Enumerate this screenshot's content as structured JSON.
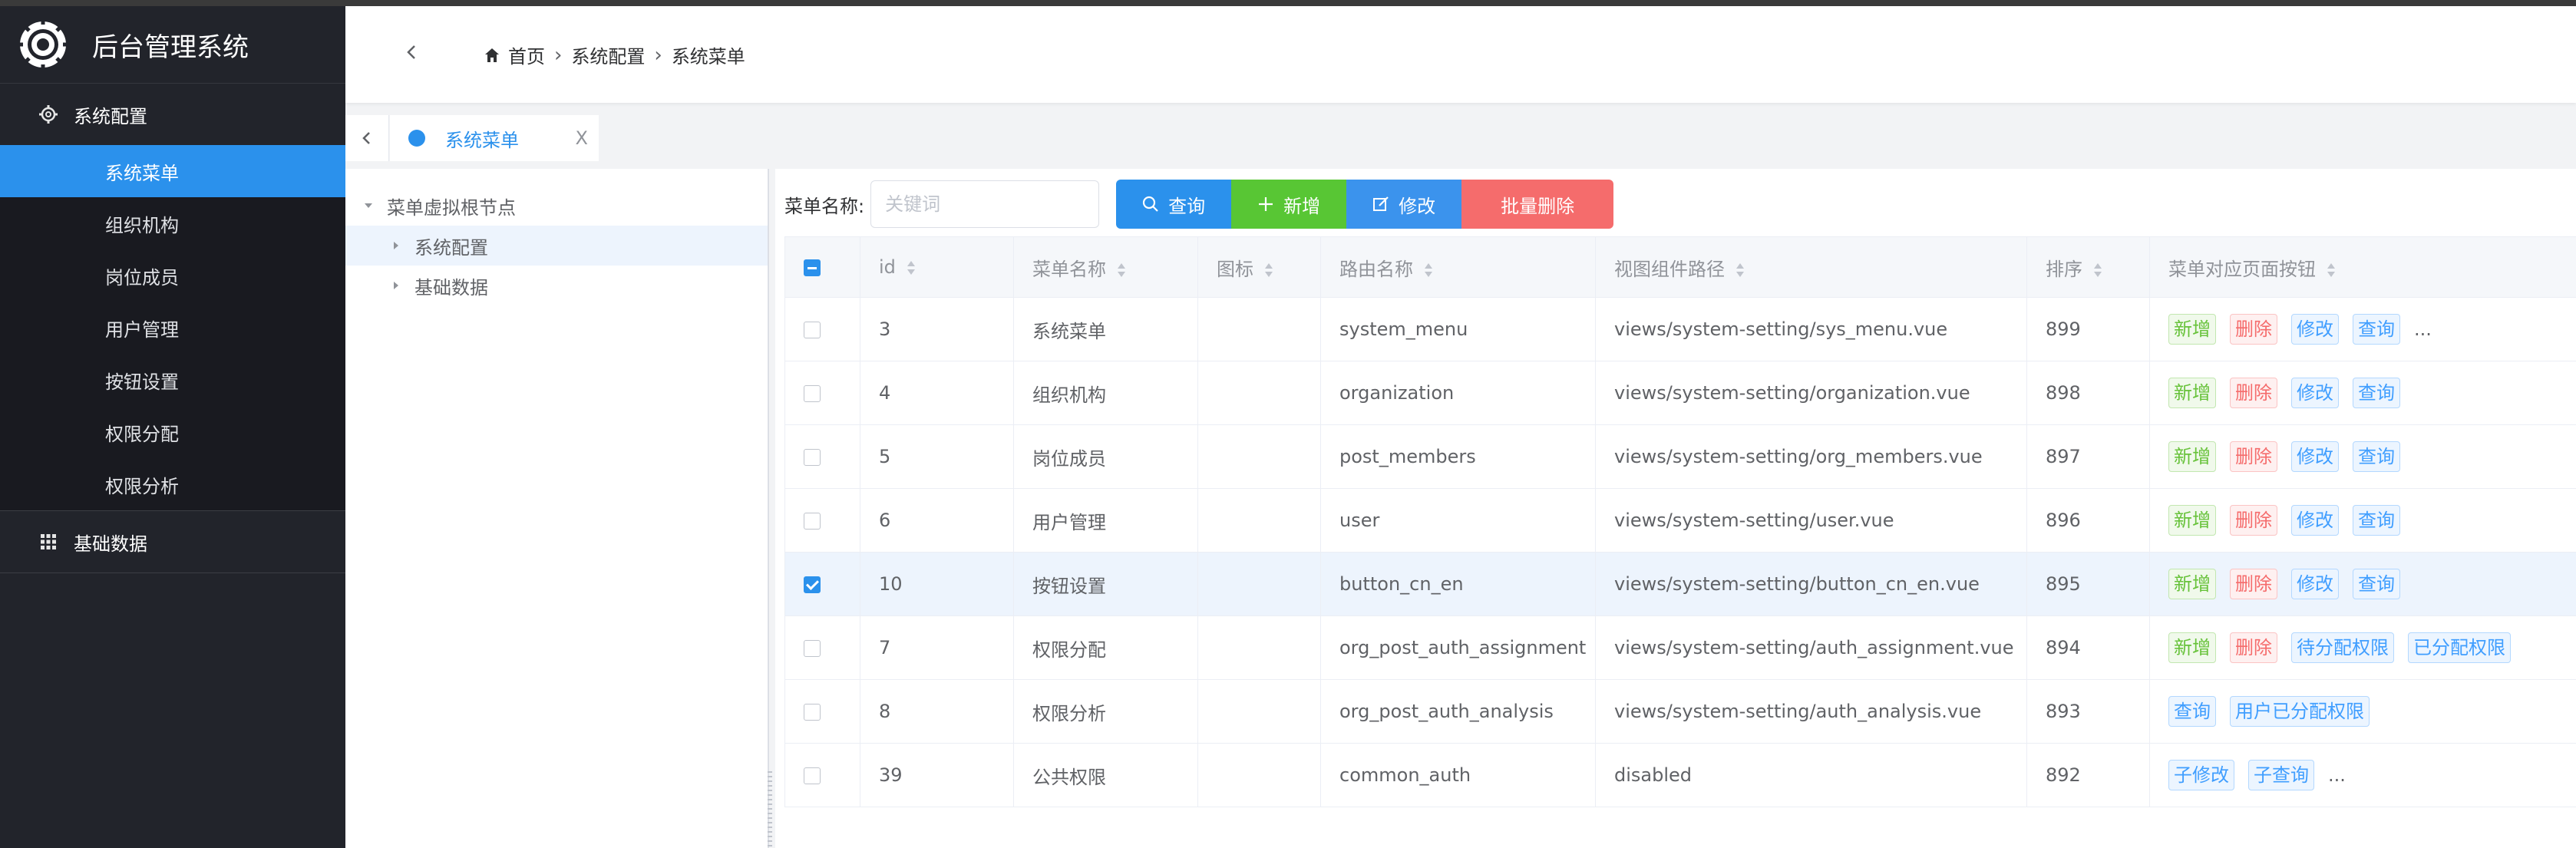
{
  "app": {
    "title": "后台管理系统"
  },
  "sidebar": {
    "groups": [
      {
        "label": "系统配置",
        "icon": "gear-icon",
        "items": [
          "系统菜单",
          "组织机构",
          "岗位成员",
          "用户管理",
          "按钮设置",
          "权限分配",
          "权限分析"
        ],
        "active_index": 0
      },
      {
        "label": "基础数据",
        "icon": "grid-icon"
      }
    ]
  },
  "breadcrumb": [
    "首页",
    "系统配置",
    "系统菜单"
  ],
  "tabs": [
    {
      "label": "系统菜单",
      "close": "X"
    }
  ],
  "tree": {
    "root": "菜单虚拟根节点",
    "children": [
      "系统配置",
      "基础数据"
    ],
    "selected_index": 0
  },
  "toolbar": {
    "search_label": "菜单名称:",
    "search_placeholder": "关键词",
    "search_value": "",
    "query": "查询",
    "add": "新增",
    "edit": "修改",
    "batch_delete": "批量删除"
  },
  "table": {
    "columns": [
      "id",
      "菜单名称",
      "图标",
      "路由名称",
      "视图组件路径",
      "排序",
      "菜单对应页面按钮"
    ],
    "rows": [
      {
        "checked": false,
        "id": "3",
        "name": "系统菜单",
        "icon": "",
        "route": "system_menu",
        "path": "views/system-setting/sys_menu.vue",
        "sort": "899",
        "buttons": [
          {
            "text": "新增",
            "color": "green"
          },
          {
            "text": "删除",
            "color": "red"
          },
          {
            "text": "修改",
            "color": "blue"
          },
          {
            "text": "查询",
            "color": "blue"
          }
        ],
        "more": "..."
      },
      {
        "checked": false,
        "id": "4",
        "name": "组织机构",
        "icon": "",
        "route": "organization",
        "path": "views/system-setting/organization.vue",
        "sort": "898",
        "buttons": [
          {
            "text": "新增",
            "color": "green"
          },
          {
            "text": "删除",
            "color": "red"
          },
          {
            "text": "修改",
            "color": "blue"
          },
          {
            "text": "查询",
            "color": "blue"
          }
        ],
        "more": ""
      },
      {
        "checked": false,
        "id": "5",
        "name": "岗位成员",
        "icon": "",
        "route": "post_members",
        "path": "views/system-setting/org_members.vue",
        "sort": "897",
        "buttons": [
          {
            "text": "新增",
            "color": "green"
          },
          {
            "text": "删除",
            "color": "red"
          },
          {
            "text": "修改",
            "color": "blue"
          },
          {
            "text": "查询",
            "color": "blue"
          }
        ],
        "more": ""
      },
      {
        "checked": false,
        "id": "6",
        "name": "用户管理",
        "icon": "",
        "route": "user",
        "path": "views/system-setting/user.vue",
        "sort": "896",
        "buttons": [
          {
            "text": "新增",
            "color": "green"
          },
          {
            "text": "删除",
            "color": "red"
          },
          {
            "text": "修改",
            "color": "blue"
          },
          {
            "text": "查询",
            "color": "blue"
          }
        ],
        "more": ""
      },
      {
        "checked": true,
        "id": "10",
        "name": "按钮设置",
        "icon": "",
        "route": "button_cn_en",
        "path": "views/system-setting/button_cn_en.vue",
        "sort": "895",
        "buttons": [
          {
            "text": "新增",
            "color": "green"
          },
          {
            "text": "删除",
            "color": "red"
          },
          {
            "text": "修改",
            "color": "blue"
          },
          {
            "text": "查询",
            "color": "blue"
          }
        ],
        "more": ""
      },
      {
        "checked": false,
        "id": "7",
        "name": "权限分配",
        "icon": "",
        "route": "org_post_auth_assignment",
        "path": "views/system-setting/auth_assignment.vue",
        "sort": "894",
        "buttons": [
          {
            "text": "新增",
            "color": "green"
          },
          {
            "text": "删除",
            "color": "red"
          },
          {
            "text": "待分配权限",
            "color": "blue"
          },
          {
            "text": "已分配权限",
            "color": "blue"
          }
        ],
        "more": ""
      },
      {
        "checked": false,
        "id": "8",
        "name": "权限分析",
        "icon": "",
        "route": "org_post_auth_analysis",
        "path": "views/system-setting/auth_analysis.vue",
        "sort": "893",
        "buttons": [
          {
            "text": "查询",
            "color": "blue"
          },
          {
            "text": "用户已分配权限",
            "color": "blue"
          }
        ],
        "more": ""
      },
      {
        "checked": false,
        "id": "39",
        "name": "公共权限",
        "icon": "",
        "route": "common_auth",
        "path": "disabled",
        "sort": "892",
        "buttons": [
          {
            "text": "子修改",
            "color": "blue"
          },
          {
            "text": "子查询",
            "color": "blue"
          }
        ],
        "more": "..."
      }
    ]
  },
  "colors": {
    "sidebar_bg": "#22242b",
    "active": "#2b91ec",
    "success": "#58c634",
    "danger": "#f56c6c"
  }
}
